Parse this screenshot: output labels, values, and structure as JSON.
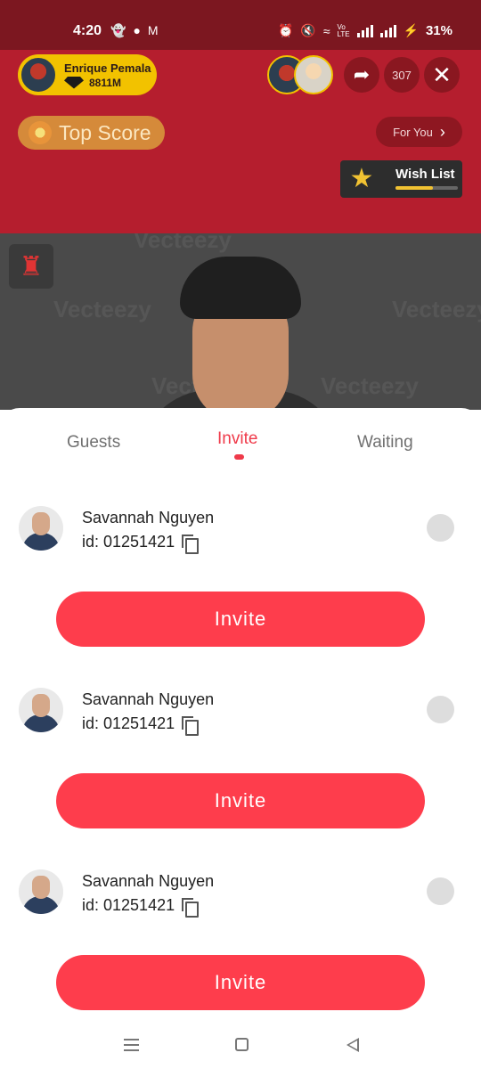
{
  "status_bar": {
    "time": "4:20",
    "left_icons": [
      "snapchat-icon",
      "chat-icon",
      "gmail-icon"
    ],
    "right_icons": [
      "alarm-icon",
      "mute-icon",
      "wifi-icon",
      "volte-icon",
      "signal-icon",
      "signal-icon",
      "charging-icon"
    ],
    "volte_label": "Vo LTE",
    "battery": "31%"
  },
  "live": {
    "host": {
      "name": "Enrique Pemala",
      "coins": "8811M"
    },
    "viewer_count": "307",
    "top_score_label": "Top Score",
    "for_you_label": "For You",
    "wish_list": {
      "label": "Wish List",
      "progress": 0.6
    },
    "watermark": "Vecteezy",
    "colors": {
      "header": "#b51e2e",
      "accent": "#fe3d4c"
    }
  },
  "sheet": {
    "tabs": [
      {
        "label": "Guests",
        "active": false
      },
      {
        "label": "Invite",
        "active": true
      },
      {
        "label": "Waiting",
        "active": false
      }
    ],
    "users": [
      {
        "name": "Savannah Nguyen",
        "id": "id: 01251421",
        "action": "Invite"
      },
      {
        "name": "Savannah Nguyen",
        "id": "id: 01251421",
        "action": "Invite"
      },
      {
        "name": "Savannah Nguyen",
        "id": "id: 01251421",
        "action": "Invite"
      }
    ]
  }
}
